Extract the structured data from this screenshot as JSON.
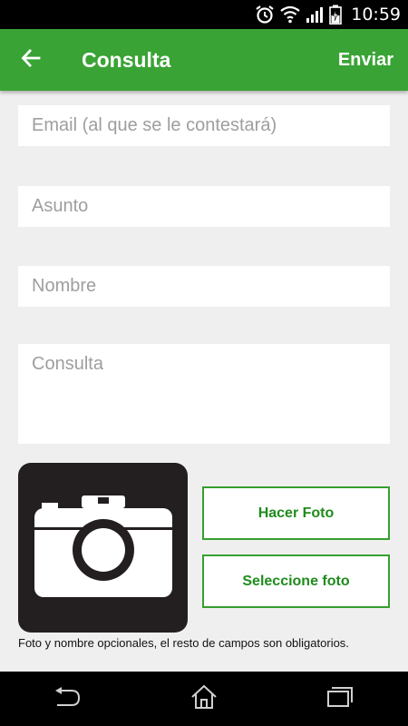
{
  "status_bar": {
    "time": "10:59",
    "icons": [
      "alarm-icon",
      "wifi-icon",
      "signal-icon",
      "battery-charging-icon"
    ]
  },
  "app_bar": {
    "back_icon": "arrow-left-icon",
    "title": "Consulta",
    "action_label": "Enviar",
    "background": "#3aa335"
  },
  "form": {
    "email": {
      "value": "",
      "placeholder": "Email (al que se le contestará)"
    },
    "subject": {
      "value": "",
      "placeholder": "Asunto"
    },
    "name": {
      "value": "",
      "placeholder": "Nombre"
    },
    "message": {
      "value": "",
      "placeholder": "Consulta"
    }
  },
  "photo": {
    "icon": "camera-icon",
    "take_photo_label": "Hacer Foto",
    "select_photo_label": "Seleccione foto",
    "accent": "#35a02f"
  },
  "note": "Foto y nombre opcionales, el resto de campos son obligatorios.",
  "nav_bar": {
    "icons": [
      "back-nav-icon",
      "home-icon",
      "recent-apps-icon"
    ]
  }
}
